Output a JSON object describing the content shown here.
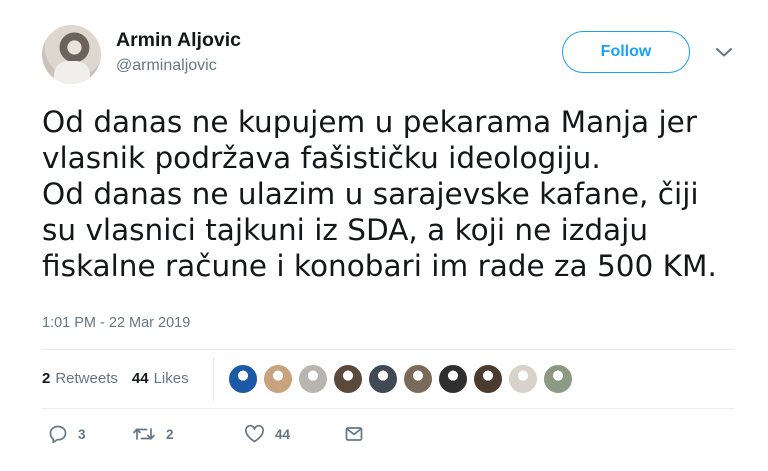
{
  "author": {
    "name": "Armin Aljovic",
    "handle": "@arminaljovic"
  },
  "follow_label": "Follow",
  "tweet_lines": [
    "Od danas ne kupujem u pekarama Manja jer",
    "vlasnik podržava fašističku ideologiju.",
    "Od danas ne ulazim u sarajevske kafane, čiji",
    "su vlasnici tajkuni iz SDA, a koji ne izdaju",
    "fiskalne račune i konobari im rade za 500 KM."
  ],
  "timestamp": "1:01 PM - 22 Mar 2019",
  "stats": {
    "retweets_count": "2",
    "retweets_label": "Retweets",
    "likes_count": "44",
    "likes_label": "Likes"
  },
  "liker_avatar_colors": [
    "#1c5aa8",
    "#c9a27e",
    "#b9b4ae",
    "#5b4a3c",
    "#3f4a55",
    "#7a6a5a",
    "#2f2f2f",
    "#4b3a2e",
    "#d8d2cb",
    "#8c9a84"
  ],
  "actions": {
    "reply_count": "3",
    "retweet_count": "2",
    "like_count": "44"
  },
  "icons": [
    "chevron-down-icon",
    "reply-icon",
    "retweet-icon",
    "heart-icon",
    "message-icon"
  ],
  "colors": {
    "accent": "#1da1f2",
    "secondary_text": "#657786",
    "primary_text": "#14171a",
    "divider": "#e6ecf0"
  }
}
